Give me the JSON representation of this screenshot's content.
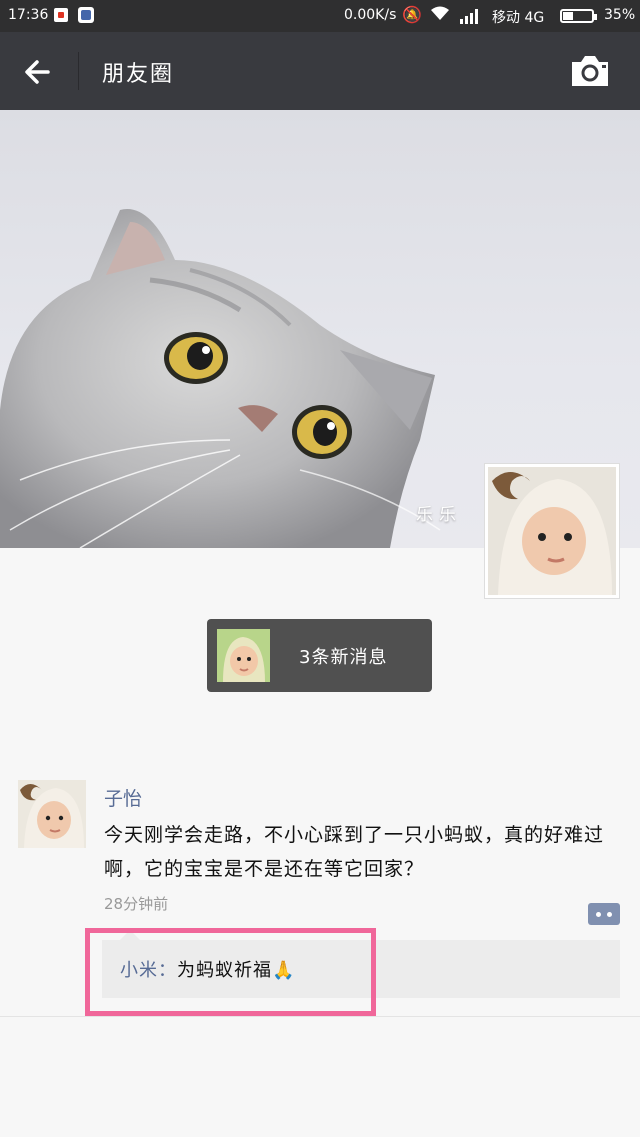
{
  "status_bar": {
    "time": "17:36",
    "net_speed": "0.00K/s",
    "carrier": "移动 4G",
    "battery": "35%",
    "battery_level": 0.35
  },
  "header": {
    "title": "朋友圈",
    "back_icon": "arrow-left-icon",
    "camera_icon": "camera-icon"
  },
  "cover": {
    "name": "乐乐"
  },
  "notification": {
    "text": "3条新消息"
  },
  "post": {
    "author": "子怡",
    "content": "今天刚学会走路，不小心踩到了一只小蚂蚁，真的好难过啊，它的宝宝是不是还在等它回家？",
    "time": "28分钟前",
    "comments": [
      {
        "user": "小米",
        "separator": "：",
        "text": "为蚂蚁祈福🙏"
      }
    ]
  },
  "colors": {
    "header_bg": "#393a3f",
    "link": "#576b95",
    "highlight": "#f0679a"
  }
}
